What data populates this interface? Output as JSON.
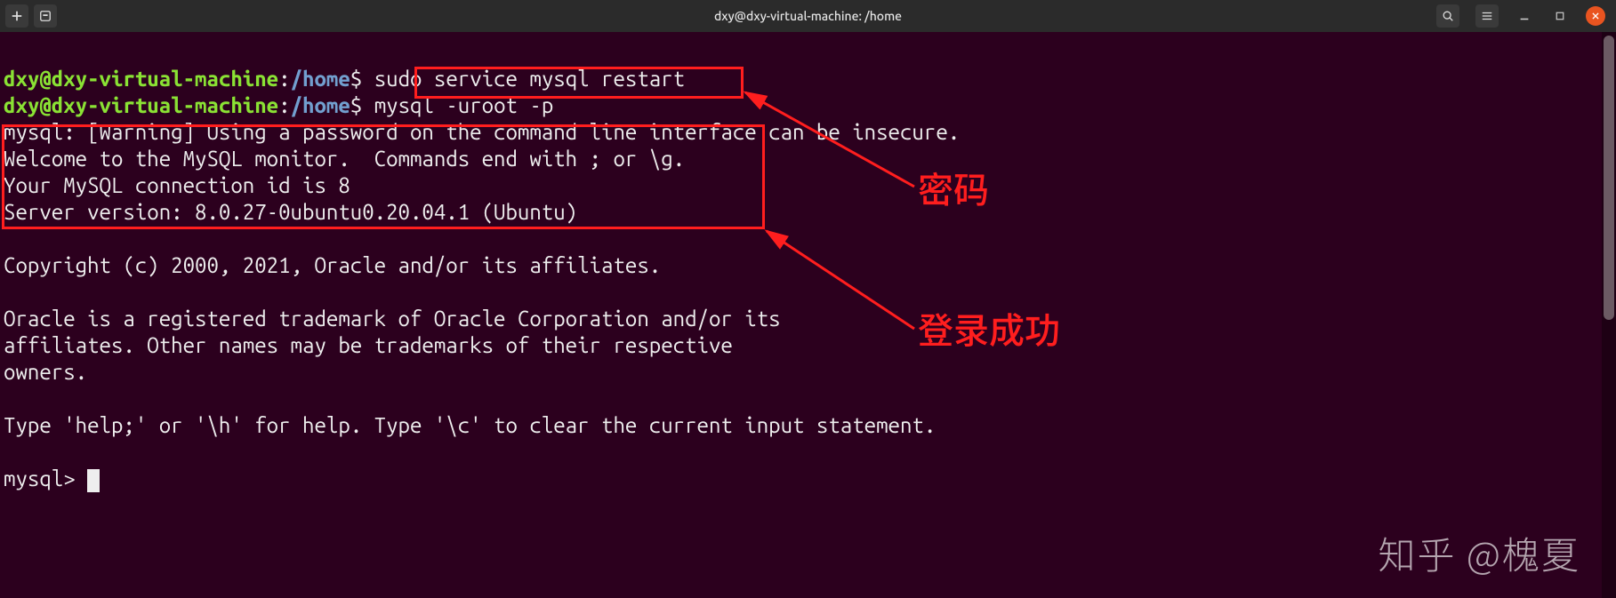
{
  "titlebar": {
    "title": "dxy@dxy-virtual-machine: /home"
  },
  "prompt": {
    "userhost": "dxy@dxy-virtual-machine",
    "colon": ":",
    "path": "/home",
    "sigil": "$"
  },
  "lines": {
    "cmd1": "sudo service mysql restart",
    "cmd2": "mysql -uroot -p",
    "warn": "mysql: [Warning] Using a password on the command line interface can be insecure.",
    "welcome": "Welcome to the MySQL monitor.  Commands end with ; or \\g.",
    "connid": "Your MySQL connection id is 8",
    "serverver": "Server version: 8.0.27-0ubuntu0.20.04.1 (Ubuntu)",
    "copyright": "Copyright (c) 2000, 2021, Oracle and/or its affiliates.",
    "tm1": "Oracle is a registered trademark of Oracle Corporation and/or its",
    "tm2": "affiliates. Other names may be trademarks of their respective",
    "tm3": "owners.",
    "help": "Type 'help;' or '\\h' for help. Type '\\c' to clear the current input statement.",
    "mysqlprompt": "mysql> "
  },
  "annotations": {
    "password": "密码",
    "login_ok": "登录成功"
  },
  "watermark": "知乎 @槐夏"
}
